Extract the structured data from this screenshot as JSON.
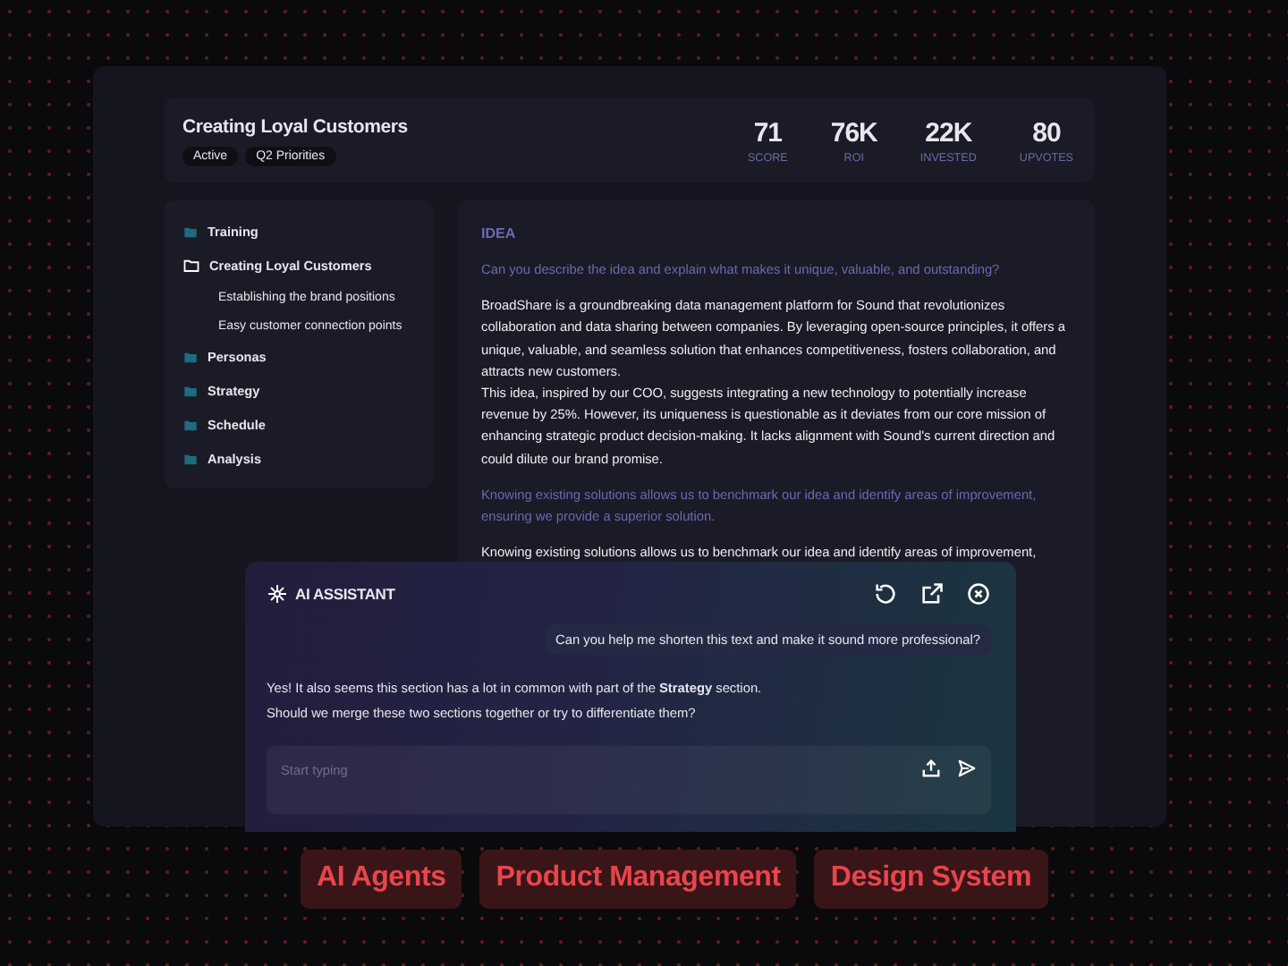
{
  "header": {
    "title": "Creating Loyal Customers",
    "tags": [
      "Active",
      "Q2 Priorities"
    ],
    "stats": [
      {
        "value": "71",
        "label": "SCORE"
      },
      {
        "value": "76K",
        "label": "ROI"
      },
      {
        "value": "22K",
        "label": "INVESTED"
      },
      {
        "value": "80",
        "label": "UPVOTES"
      }
    ]
  },
  "sidebar": {
    "items": [
      {
        "label": "Training",
        "selected": false
      },
      {
        "label": "Creating Loyal Customers",
        "selected": true,
        "children": [
          {
            "label": "Establishing the brand positions"
          },
          {
            "label": "Easy customer connection points"
          }
        ]
      },
      {
        "label": "Personas",
        "selected": false
      },
      {
        "label": "Strategy",
        "selected": false
      },
      {
        "label": "Schedule",
        "selected": false
      },
      {
        "label": "Analysis",
        "selected": false
      }
    ]
  },
  "idea": {
    "heading": "IDEA",
    "blocks": [
      {
        "kind": "prompt",
        "text": "Can you describe the idea and explain what makes it unique, valuable, and outstanding?"
      },
      {
        "kind": "body",
        "text": "BroadShare is a groundbreaking data management platform for Sound that revolutionizes collaboration and data sharing between companies. By leveraging open-source principles, it offers a unique, valuable, and seamless solution that enhances competitiveness, fosters collaboration, and attracts new customers."
      },
      {
        "kind": "body_cont",
        "text": "This idea, inspired by our COO, suggests integrating a new technology to potentially increase revenue by 25%. However, its uniqueness is questionable as it deviates from our core mission of enhancing strategic product decision-making. It lacks alignment with Sound's current direction and could dilute our brand promise."
      },
      {
        "kind": "prompt",
        "text": "Knowing existing solutions allows us to benchmark our idea and identify areas of improvement, ensuring we provide a superior solution."
      },
      {
        "kind": "body",
        "text": "Knowing existing solutions allows us to benchmark our idea and identify areas of improvement,"
      }
    ]
  },
  "assistant": {
    "title": "AI ASSISTANT",
    "messages": [
      {
        "kind": "user",
        "text": "Can you help me shorten this text and make it sound more professional?"
      },
      {
        "kind": "assistant",
        "text": "Yes! It also seems this section has a lot in common with part of the **Strategy** section. Should we merge these two sections together or try to differentiate them?"
      }
    ],
    "input": {
      "placeholder": "Start typing"
    }
  },
  "topics": [
    "AI Agents",
    "Product Management",
    "Design System"
  ]
}
